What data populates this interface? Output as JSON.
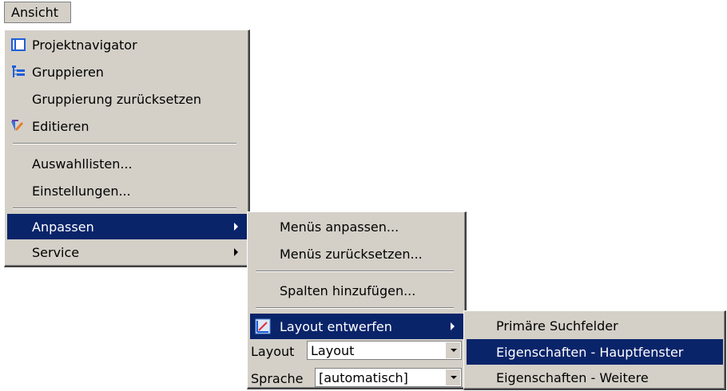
{
  "menubar": {
    "ansicht": "Ansicht"
  },
  "menu1": {
    "projektnavigator": "Projektnavigator",
    "gruppieren": "Gruppieren",
    "gruppierung_zuruecksetzen": "Gruppierung zurücksetzen",
    "editieren": "Editieren",
    "auswahllisten": "Auswahllisten...",
    "einstellungen": "Einstellungen...",
    "anpassen": "Anpassen",
    "service": "Service"
  },
  "menu2": {
    "menues_anpassen": "Menüs anpassen...",
    "menues_zuruecksetzen": "Menüs zurücksetzen...",
    "spalten_hinzufuegen": "Spalten hinzufügen...",
    "layout_entwerfen": "Layout entwerfen",
    "layout_label": "Layout",
    "layout_value": "Layout",
    "sprache_label": "Sprache",
    "sprache_value": "[automatisch]"
  },
  "menu3": {
    "primaere_suchfelder": "Primäre Suchfelder",
    "eigenschaften_hauptfenster": "Eigenschaften - Hauptfenster",
    "eigenschaften_weitere": "Eigenschaften - Weitere"
  },
  "icons": {
    "projektnavigator": "panel-icon",
    "gruppieren": "tree-icon",
    "editieren": "edit-pen-icon",
    "layout_entwerfen": "layout-design-icon"
  },
  "colors": {
    "menu_bg": "#d4d0c8",
    "highlight": "#0a246a",
    "highlight_text": "#ffffff"
  }
}
